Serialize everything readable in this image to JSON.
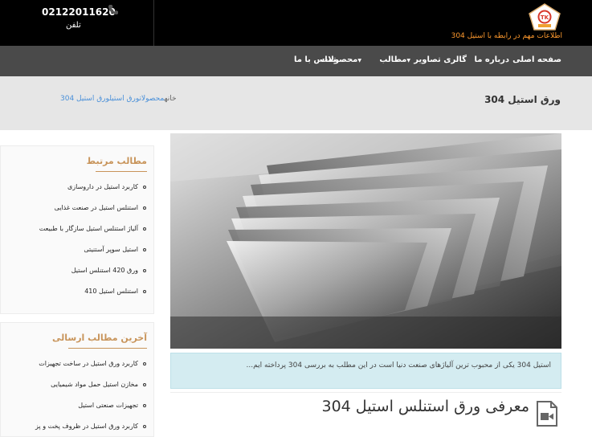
{
  "header": {
    "phone_number": "02122011620",
    "phone_label": "تلفن",
    "tagline": "اطلاعات مهم در رابطه با استیل 304",
    "logo_icon": "brand-logo-icon",
    "phone_icon": "phone-icon",
    "colors": {
      "background": "#000000",
      "tagline": "#ff9a2e"
    }
  },
  "nav": {
    "home": "صفحه اصلی",
    "about": "درباره ما",
    "gallery": "گالری تصاویر",
    "articles": "مطالب",
    "products": "محصولات",
    "contact": "تماس با ما"
  },
  "page": {
    "title": "ورق استیل 304",
    "breadcrumb": {
      "home": "خانه",
      "products": "محصولات",
      "sheet": "ورق استیل",
      "current": "ورق استیل 304"
    }
  },
  "sidebar": {
    "related": {
      "title": "مطالب مرتبط",
      "items": [
        "کاربرد استیل در داروسازی",
        "استنلس استیل در صنعت غذایی",
        "آلیاژ استنلس استیل سازگار با طبیعت",
        "استیل سوپر آستنیتی",
        "ورق 420 استنلس استیل",
        "استنلس استیل 410"
      ]
    },
    "latest": {
      "title": "آخرین مطالب ارسالی",
      "items": [
        "کاربرد ورق استیل در ساخت تجهیزات",
        "مخازن استیل حمل مواد شیمیایی",
        "تجهیزات صنعتی استیل",
        "کاربرد ورق استیل در ظروف پخت و پز"
      ]
    },
    "accent_color": "#c8945a"
  },
  "main": {
    "excerpt": "استیل 304 یکی از محبوب ترین آلیاژهای صنعت دنیا است در این مطلب به بررسی 304 پرداخته ایم...",
    "article_title": "معرفی ورق استنلس استیل 304",
    "video_icon": "video-file-icon"
  }
}
